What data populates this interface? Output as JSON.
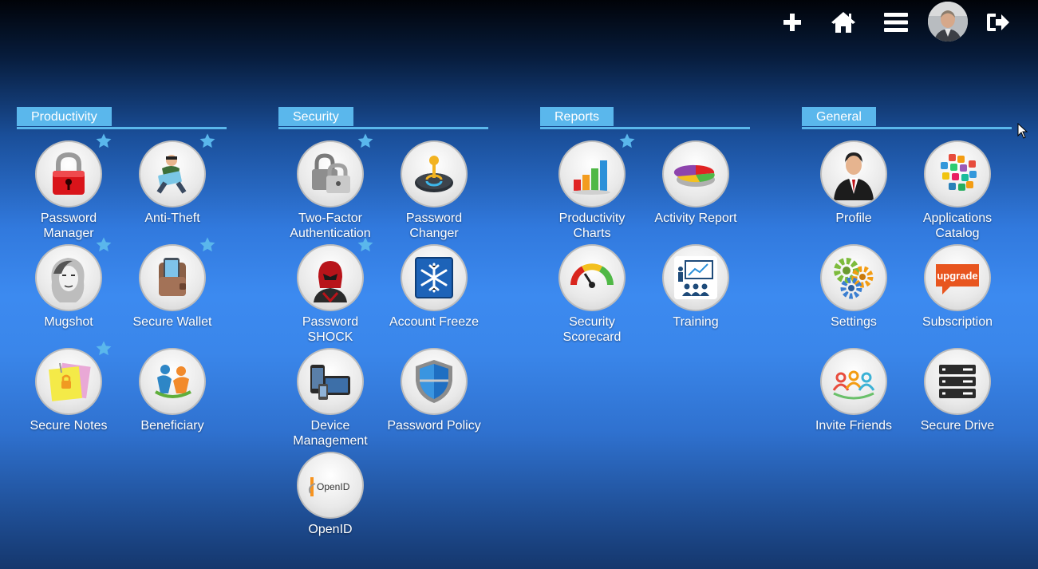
{
  "colors": {
    "section_accent": "#5ab7ec",
    "star": "#5ab7ec",
    "background_top": "#010308",
    "background_mid": "#3c8af0"
  },
  "topbar": [
    {
      "name": "add-button",
      "icon": "plus-icon"
    },
    {
      "name": "home-button",
      "icon": "home-icon"
    },
    {
      "name": "menu-button",
      "icon": "hamburger-icon"
    },
    {
      "name": "user-avatar",
      "icon": "avatar"
    },
    {
      "name": "logout-button",
      "icon": "logout-icon"
    }
  ],
  "sections": [
    {
      "label": "Productivity",
      "apps": [
        {
          "label": "Password Manager",
          "icon": "padlock-icon",
          "star": true
        },
        {
          "label": "Anti-Theft",
          "icon": "thief-icon",
          "star": true
        },
        {
          "label": "Mugshot",
          "icon": "mugshot-icon",
          "star": true
        },
        {
          "label": "Secure Wallet",
          "icon": "wallet-icon",
          "star": true
        },
        {
          "label": "Secure Notes",
          "icon": "sticky-note-icon",
          "star": true
        },
        {
          "label": "Beneficiary",
          "icon": "people-icon",
          "star": false
        }
      ]
    },
    {
      "label": "Security",
      "apps": [
        {
          "label": "Two-Factor Authentication",
          "icon": "locks-icon",
          "star": true
        },
        {
          "label": "Password Changer",
          "icon": "key-dial-icon",
          "star": false
        },
        {
          "label": "Password SHOCK",
          "icon": "helmet-icon",
          "star": true
        },
        {
          "label": "Account Freeze",
          "icon": "snowflake-icon",
          "star": false
        },
        {
          "label": "Device Management",
          "icon": "devices-icon",
          "star": false
        },
        {
          "label": "Password Policy",
          "icon": "shield-icon",
          "star": false
        },
        {
          "label": "OpenID",
          "icon": "openid-icon",
          "star": false,
          "logo_text": "OpenID"
        }
      ]
    },
    {
      "label": "Reports",
      "apps": [
        {
          "label": "Productivity Charts",
          "icon": "bar-chart-icon",
          "star": true
        },
        {
          "label": "Activity Report",
          "icon": "pie-chart-icon",
          "star": false
        },
        {
          "label": "Security Scorecard",
          "icon": "gauge-icon",
          "star": false
        },
        {
          "label": "Training",
          "icon": "presentation-icon",
          "star": false
        }
      ]
    },
    {
      "label": "General",
      "apps": [
        {
          "label": "Profile",
          "icon": "businessman-icon",
          "star": false
        },
        {
          "label": "Applications Catalog",
          "icon": "app-cluster-icon",
          "star": false
        },
        {
          "label": "Settings",
          "icon": "gears-icon",
          "star": false
        },
        {
          "label": "Subscription",
          "icon": "upgrade-icon",
          "star": false,
          "badge_text": "upgrade"
        },
        {
          "label": "Invite Friends",
          "icon": "friends-icon",
          "star": false
        },
        {
          "label": "Secure Drive",
          "icon": "server-icon",
          "star": false
        }
      ]
    }
  ]
}
